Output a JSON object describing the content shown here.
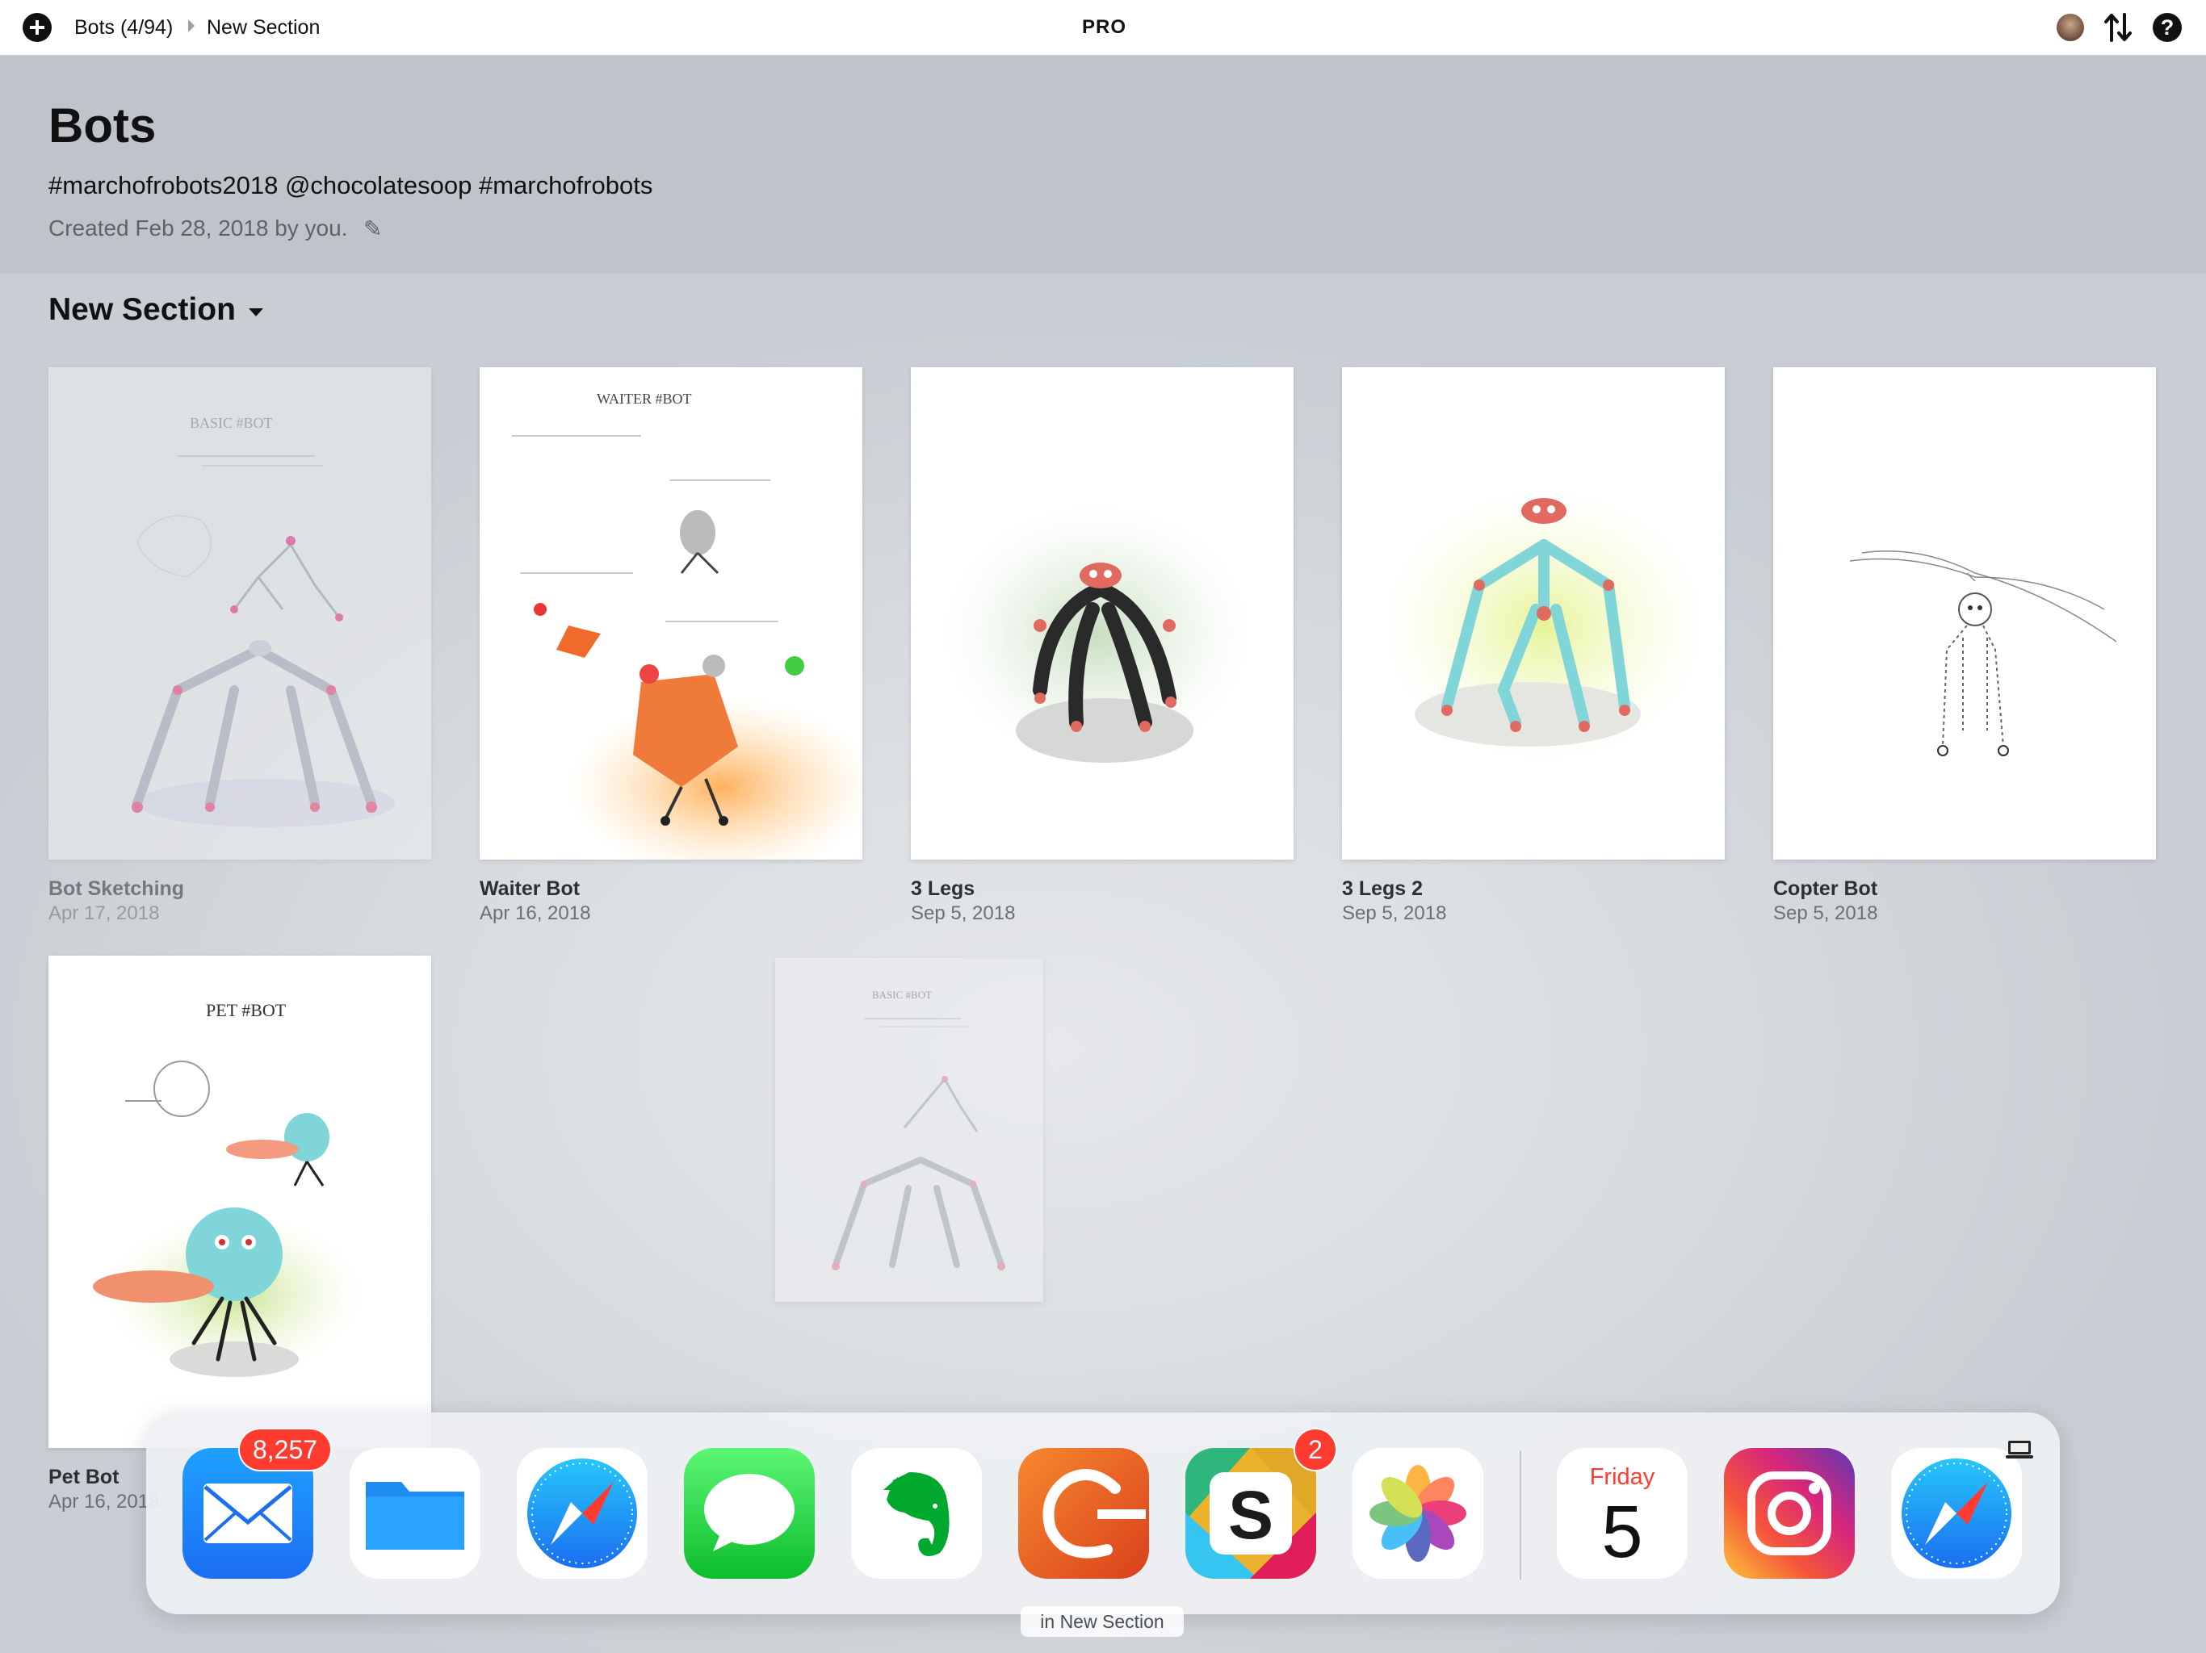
{
  "topbar": {
    "breadcrumb_notebook": "Bots (4/94)",
    "breadcrumb_section": "New Section",
    "badge": "PRO"
  },
  "header": {
    "title": "Bots",
    "tags": "#marchofrobots2018 @chocolatesoop #marchofrobots",
    "created": "Created Feb 28, 2018 by you.",
    "edit_glyph": "✎"
  },
  "section": {
    "title": "New Section"
  },
  "cards": [
    {
      "title": "Bot Sketching",
      "date": "Apr 17, 2018",
      "sketch_title": "BASIC #BOT"
    },
    {
      "title": "Waiter Bot",
      "date": "Apr 16, 2018",
      "sketch_title": "WAITER #BOT"
    },
    {
      "title": "3 Legs",
      "date": "Sep 5, 2018"
    },
    {
      "title": "3 Legs 2",
      "date": "Sep 5, 2018"
    },
    {
      "title": "Copter Bot",
      "date": "Sep 5, 2018"
    },
    {
      "title": "Pet Bot",
      "date": "Apr 16, 2018",
      "sketch_title": "PET #BOT"
    }
  ],
  "drag_ghost": {
    "sketch_title": "BASIC #BOT"
  },
  "dock": {
    "apps": [
      {
        "name": "Mail",
        "icon": "mail-icon",
        "badge": "8,257"
      },
      {
        "name": "Files",
        "icon": "files-icon"
      },
      {
        "name": "Safari",
        "icon": "safari-icon"
      },
      {
        "name": "Messages",
        "icon": "messages-icon"
      },
      {
        "name": "Evernote",
        "icon": "evernote-icon"
      },
      {
        "name": "Gestimer",
        "icon": "gestimer-icon"
      },
      {
        "name": "Slack",
        "icon": "slack-icon",
        "badge": "2"
      },
      {
        "name": "Photos",
        "icon": "photos-icon"
      },
      {
        "name": "Calendar",
        "icon": "calendar-icon",
        "day_name": "Friday",
        "day_number": "5"
      },
      {
        "name": "Instagram",
        "icon": "instagram-icon"
      },
      {
        "name": "Safari",
        "icon": "safari-icon"
      }
    ]
  },
  "status": {
    "label": "in New Section"
  },
  "colors": {
    "accent_red": "#ff3b30",
    "mail_blue": "#1e90ff",
    "messages_green": "#34c759",
    "evernote_green": "#00a82d",
    "slack_green": "#2eb67d"
  }
}
